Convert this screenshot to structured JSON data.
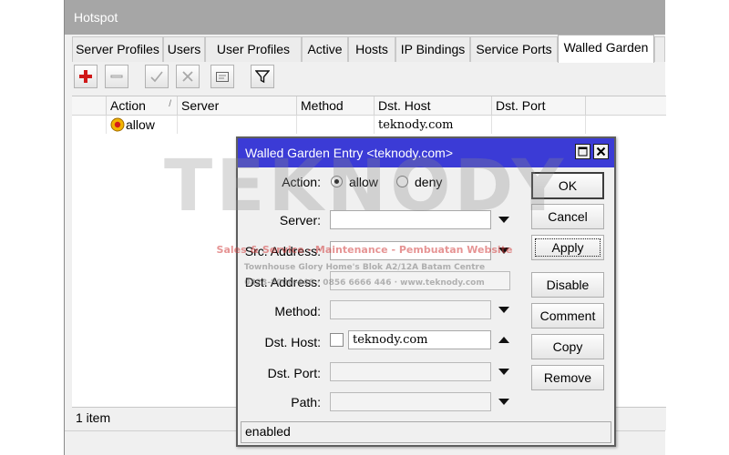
{
  "window": {
    "title": "Hotspot"
  },
  "tabs": [
    {
      "label": "Server Profiles"
    },
    {
      "label": "Users"
    },
    {
      "label": "User Profiles"
    },
    {
      "label": "Active"
    },
    {
      "label": "Hosts"
    },
    {
      "label": "IP Bindings"
    },
    {
      "label": "Service Ports"
    },
    {
      "label": "Walled Garden"
    }
  ],
  "active_tab": "Walled Garden",
  "toolbar": {
    "buttons": [
      "add-icon",
      "remove-icon",
      "enable-icon",
      "disable-icon",
      "comment-icon",
      "filter-icon"
    ],
    "accent": "#d01818"
  },
  "table": {
    "columns": {
      "action": "Action",
      "sort_indicator": "/",
      "server": "Server",
      "method": "Method",
      "dst_host": "Dst. Host",
      "dst_port": "Dst. Port"
    },
    "rows": [
      {
        "action": "allow",
        "server": "",
        "method": "",
        "dst_host": "teknody.com",
        "dst_port": ""
      }
    ]
  },
  "status": {
    "count": "1 item"
  },
  "dialog": {
    "title": "Walled Garden Entry <teknody.com>",
    "title_color": "#3b3bd6",
    "action": {
      "label": "Action:",
      "options": [
        {
          "label": "allow",
          "selected": true
        },
        {
          "label": "deny",
          "selected": false
        }
      ]
    },
    "fields": {
      "server": {
        "label": "Server:",
        "value": ""
      },
      "src_address": {
        "label": "Src. Address:",
        "value": ""
      },
      "dst_address": {
        "label": "Dst. Address:",
        "value": ""
      },
      "method": {
        "label": "Method:",
        "value": ""
      },
      "dst_host": {
        "label": "Dst. Host:",
        "value": "teknody.com",
        "negate": false
      },
      "dst_port": {
        "label": "Dst. Port:",
        "value": ""
      },
      "path": {
        "label": "Path:",
        "value": ""
      }
    },
    "buttons": {
      "ok": "OK",
      "cancel": "Cancel",
      "apply": "Apply",
      "disable": "Disable",
      "comment": "Comment",
      "copy": "Copy",
      "remove": "Remove"
    },
    "status": "enabled"
  },
  "watermark": {
    "brand": "TEKNODY",
    "line1": "Sales & Service - Maintenance - Pembuatan Website",
    "line2": "Townhouse Glory Home's Blok A2/12A Batam Centre",
    "line3": "0823-8000-446 · 0856 6666 446 · www.teknody.com"
  }
}
